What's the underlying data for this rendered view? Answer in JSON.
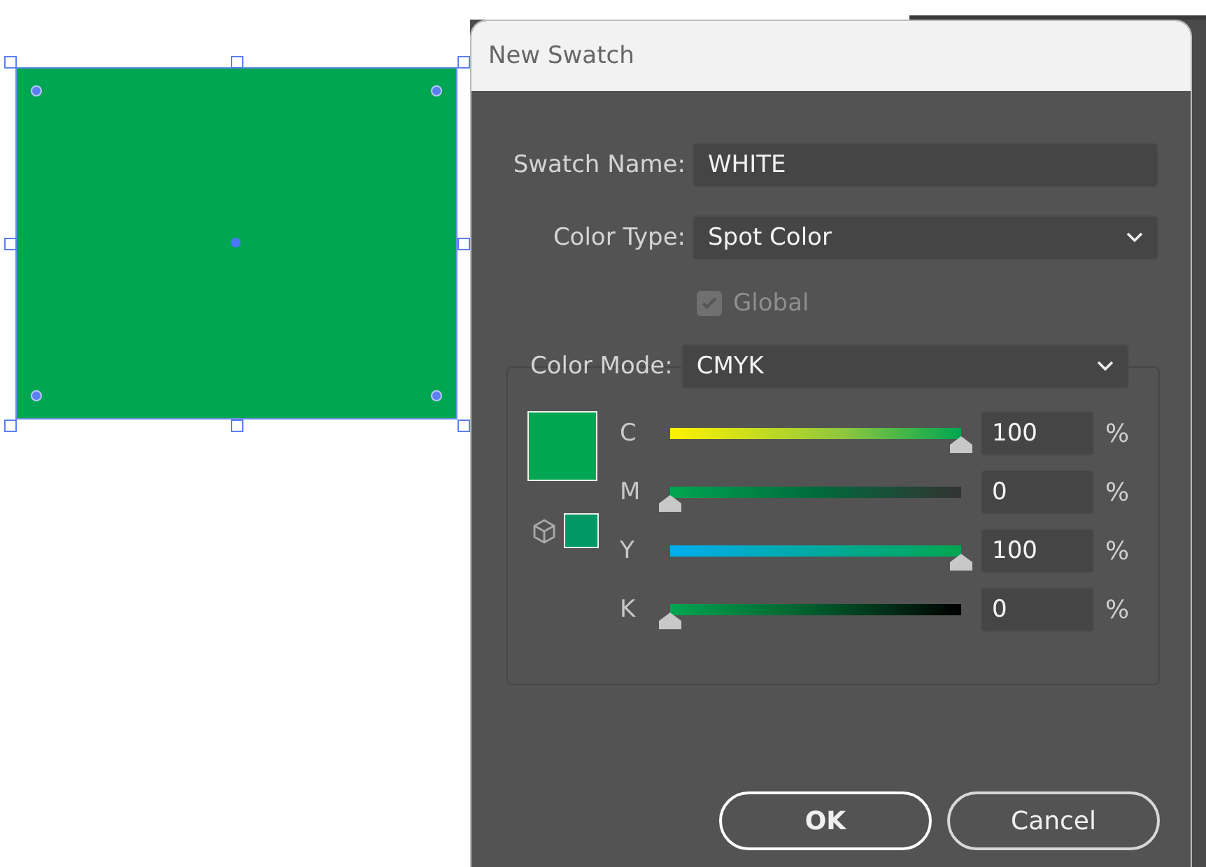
{
  "artboard": {
    "selected": true
  },
  "dialog": {
    "title": "New Swatch",
    "swatch_name": {
      "label": "Swatch Name:",
      "value": "WHITE"
    },
    "color_type": {
      "label": "Color Type:",
      "value": "Spot Color"
    },
    "global": {
      "label": "Global",
      "checked": true,
      "disabled": true
    },
    "color_mode": {
      "label": "Color Mode:",
      "value": "CMYK"
    },
    "channels": [
      {
        "name": "C",
        "level": 1,
        "value": "100",
        "unit": "%"
      },
      {
        "name": "M",
        "level": 0,
        "value": "0",
        "unit": "%"
      },
      {
        "name": "Y",
        "level": 1,
        "value": "100",
        "unit": "%"
      },
      {
        "name": "K",
        "level": 0,
        "value": "0",
        "unit": "%"
      }
    ],
    "buttons": [
      {
        "label": "OK",
        "default": true
      },
      {
        "label": "Cancel",
        "default": false
      }
    ]
  }
}
